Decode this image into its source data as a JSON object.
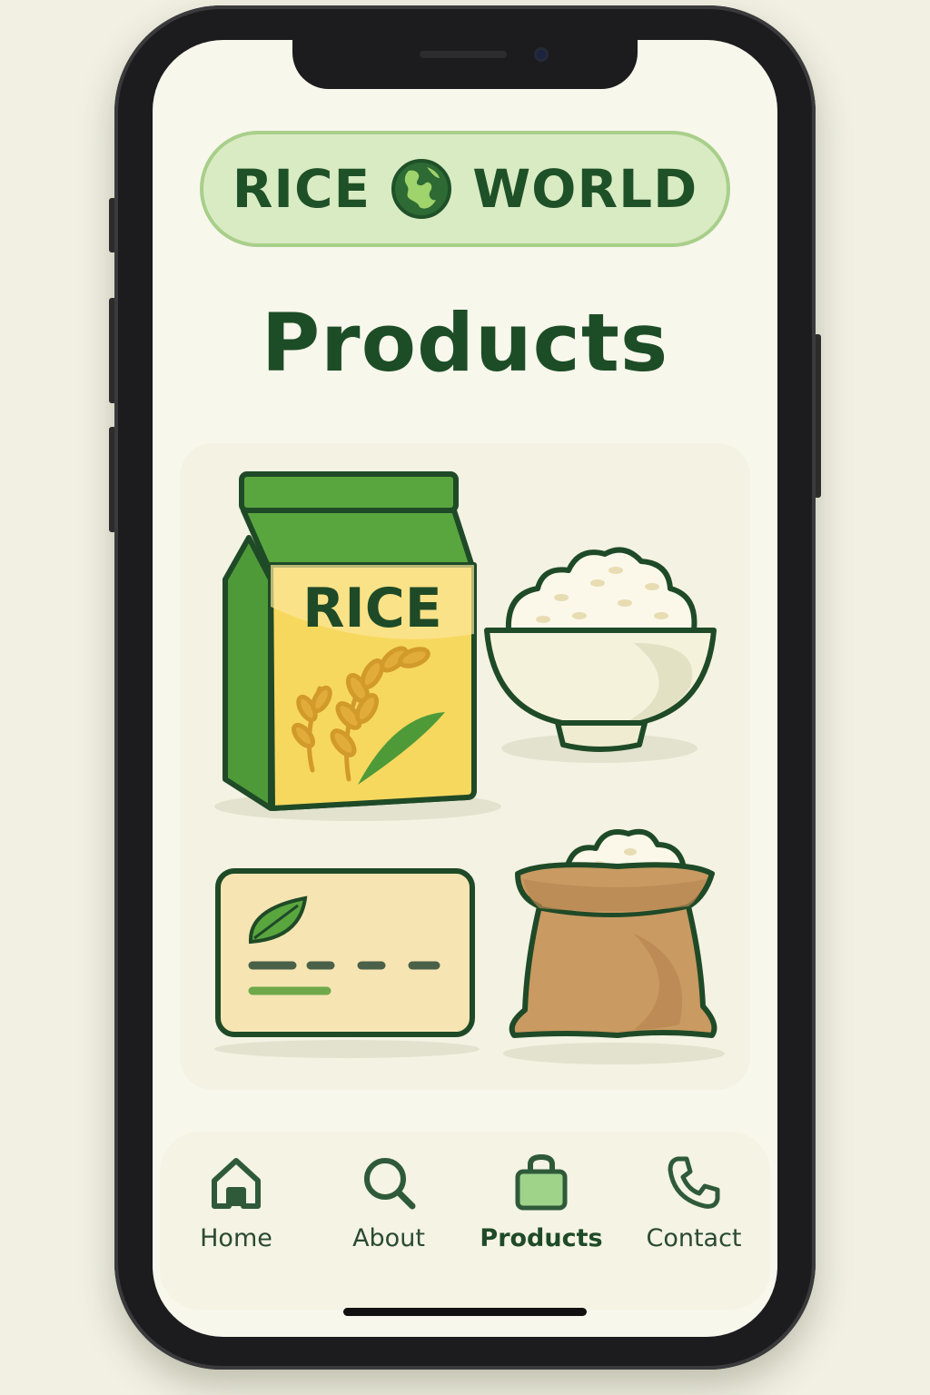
{
  "brand": {
    "word_left": "RICE",
    "word_right": "WORLD",
    "logo_icon": "globe-icon",
    "accent_color": "#1f5128",
    "pill_color": "#d9ebc2"
  },
  "page": {
    "title": "Products"
  },
  "products": {
    "bag_label": "RICE",
    "items": [
      {
        "icon": "rice-bag-icon"
      },
      {
        "icon": "rice-bowl-icon"
      },
      {
        "icon": "gift-card-icon"
      },
      {
        "icon": "rice-sack-icon"
      }
    ]
  },
  "nav": {
    "active": "Products",
    "items": [
      {
        "label": "Home",
        "icon": "home-icon"
      },
      {
        "label": "About",
        "icon": "search-icon"
      },
      {
        "label": "Products",
        "icon": "shopping-bag-icon"
      },
      {
        "label": "Contact",
        "icon": "phone-icon"
      }
    ]
  }
}
